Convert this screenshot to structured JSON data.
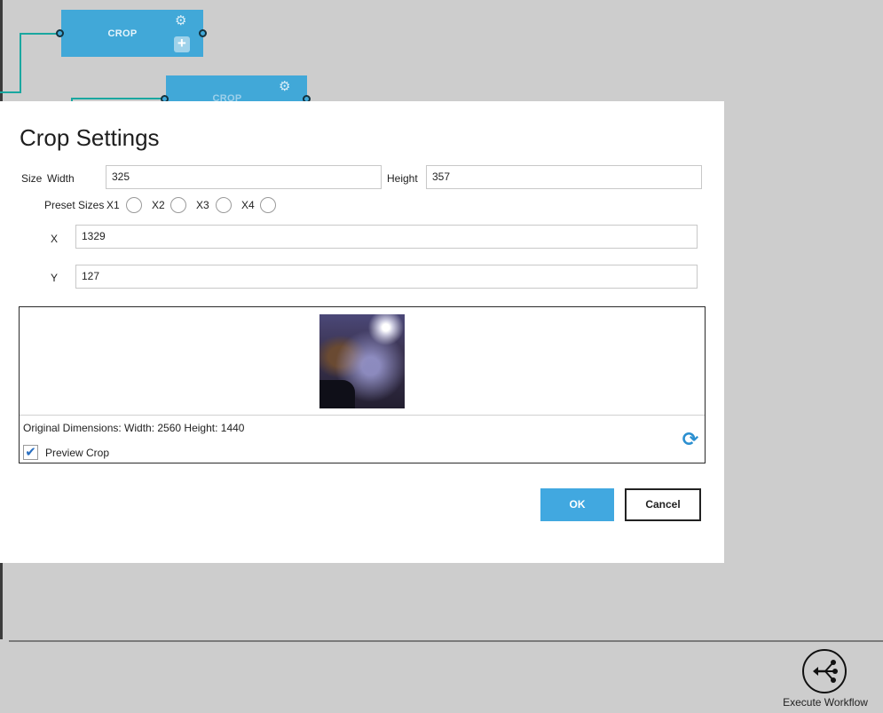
{
  "canvas": {
    "nodes": [
      {
        "label": "CROP"
      },
      {
        "label": "CROP"
      }
    ],
    "gear_icon": "⚙",
    "plus_icon": "+"
  },
  "dialog": {
    "title": "Crop Settings",
    "size_label": "Size",
    "width_label": "Width",
    "width_value": "325",
    "height_label": "Height",
    "height_value": "357",
    "preset_label": "Preset Sizes",
    "presets": [
      "X1",
      "X2",
      "X3",
      "X4"
    ],
    "x_label": "X",
    "x_value": "1329",
    "y_label": "Y",
    "y_value": "127",
    "original_dimensions": "Original Dimensions: Width: 2560 Height: 1440",
    "preview_crop_label": "Preview Crop",
    "preview_crop_checked": true,
    "check_glyph": "✔",
    "refresh_glyph": "⟳",
    "ok_label": "OK",
    "cancel_label": "Cancel"
  },
  "footer": {
    "execute_label": "Execute Workflow"
  },
  "colors": {
    "node": "#41a8d8",
    "wire": "#1aa7a0",
    "ok_button": "#41a8e0",
    "background": "#cdcdcd"
  }
}
